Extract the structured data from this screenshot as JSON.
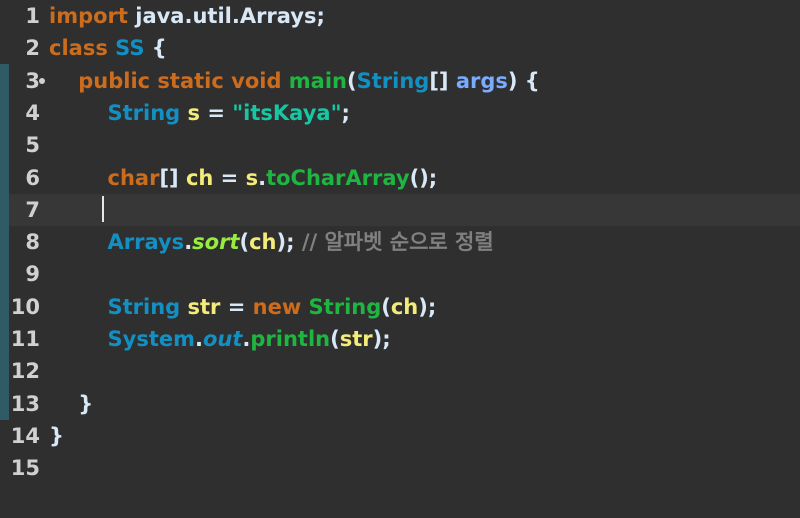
{
  "lines": [
    {
      "n": "1",
      "t": [
        {
          "c": "kw",
          "v": "import"
        },
        {
          "c": "pl",
          "v": " java.util.Arrays;"
        }
      ]
    },
    {
      "n": "2",
      "t": [
        {
          "c": "kw",
          "v": "class"
        },
        {
          "c": "pl",
          "v": " "
        },
        {
          "c": "ty",
          "v": "SS"
        },
        {
          "c": "pl",
          "v": " {"
        }
      ]
    },
    {
      "n": "3",
      "fold": true,
      "t": [
        {
          "c": "pl",
          "v": "    "
        },
        {
          "c": "kw",
          "v": "public static void"
        },
        {
          "c": "pl",
          "v": " "
        },
        {
          "c": "mt",
          "v": "main"
        },
        {
          "c": "pl",
          "v": "("
        },
        {
          "c": "ty",
          "v": "String"
        },
        {
          "c": "pl",
          "v": "[] "
        },
        {
          "c": "arg",
          "v": "args"
        },
        {
          "c": "pl",
          "v": ") {"
        }
      ]
    },
    {
      "n": "4",
      "t": [
        {
          "c": "pl",
          "v": "        "
        },
        {
          "c": "ty",
          "v": "String"
        },
        {
          "c": "pl",
          "v": " "
        },
        {
          "c": "vr",
          "v": "s"
        },
        {
          "c": "pl",
          "v": " = "
        },
        {
          "c": "st",
          "v": "\"itsKaya\""
        },
        {
          "c": "pl",
          "v": ";"
        }
      ]
    },
    {
      "n": "5",
      "t": []
    },
    {
      "n": "6",
      "t": [
        {
          "c": "pl",
          "v": "        "
        },
        {
          "c": "kw",
          "v": "char"
        },
        {
          "c": "pl",
          "v": "[] "
        },
        {
          "c": "vr",
          "v": "ch"
        },
        {
          "c": "pl",
          "v": " = "
        },
        {
          "c": "vr",
          "v": "s"
        },
        {
          "c": "pl",
          "v": "."
        },
        {
          "c": "mt",
          "v": "toCharArray"
        },
        {
          "c": "pl",
          "v": "();"
        }
      ]
    },
    {
      "n": "7",
      "current": true,
      "t": []
    },
    {
      "n": "8",
      "t": [
        {
          "c": "pl",
          "v": "        "
        },
        {
          "c": "ty",
          "v": "Arrays"
        },
        {
          "c": "pl",
          "v": "."
        },
        {
          "c": "sm it",
          "v": "sort"
        },
        {
          "c": "pl",
          "v": "("
        },
        {
          "c": "vr",
          "v": "ch"
        },
        {
          "c": "pl",
          "v": "); "
        },
        {
          "c": "cm",
          "v": "// 알파벳 순으로 정렬"
        }
      ]
    },
    {
      "n": "9",
      "t": []
    },
    {
      "n": "10",
      "t": [
        {
          "c": "pl",
          "v": "        "
        },
        {
          "c": "ty",
          "v": "String"
        },
        {
          "c": "pl",
          "v": " "
        },
        {
          "c": "vr",
          "v": "str"
        },
        {
          "c": "pl",
          "v": " = "
        },
        {
          "c": "kw",
          "v": "new"
        },
        {
          "c": "pl",
          "v": " "
        },
        {
          "c": "mt",
          "v": "String"
        },
        {
          "c": "pl",
          "v": "("
        },
        {
          "c": "vr",
          "v": "ch"
        },
        {
          "c": "pl",
          "v": ");"
        }
      ]
    },
    {
      "n": "11",
      "t": [
        {
          "c": "pl",
          "v": "        "
        },
        {
          "c": "ty",
          "v": "System"
        },
        {
          "c": "pl",
          "v": "."
        },
        {
          "c": "ty it",
          "v": "out"
        },
        {
          "c": "pl",
          "v": "."
        },
        {
          "c": "mt",
          "v": "println"
        },
        {
          "c": "pl",
          "v": "("
        },
        {
          "c": "vr",
          "v": "str"
        },
        {
          "c": "pl",
          "v": ");"
        }
      ]
    },
    {
      "n": "12",
      "t": []
    },
    {
      "n": "13",
      "t": [
        {
          "c": "pl",
          "v": "    }"
        }
      ]
    },
    {
      "n": "14",
      "t": [
        {
          "c": "pl",
          "v": "}"
        }
      ]
    },
    {
      "n": "15",
      "t": []
    }
  ]
}
